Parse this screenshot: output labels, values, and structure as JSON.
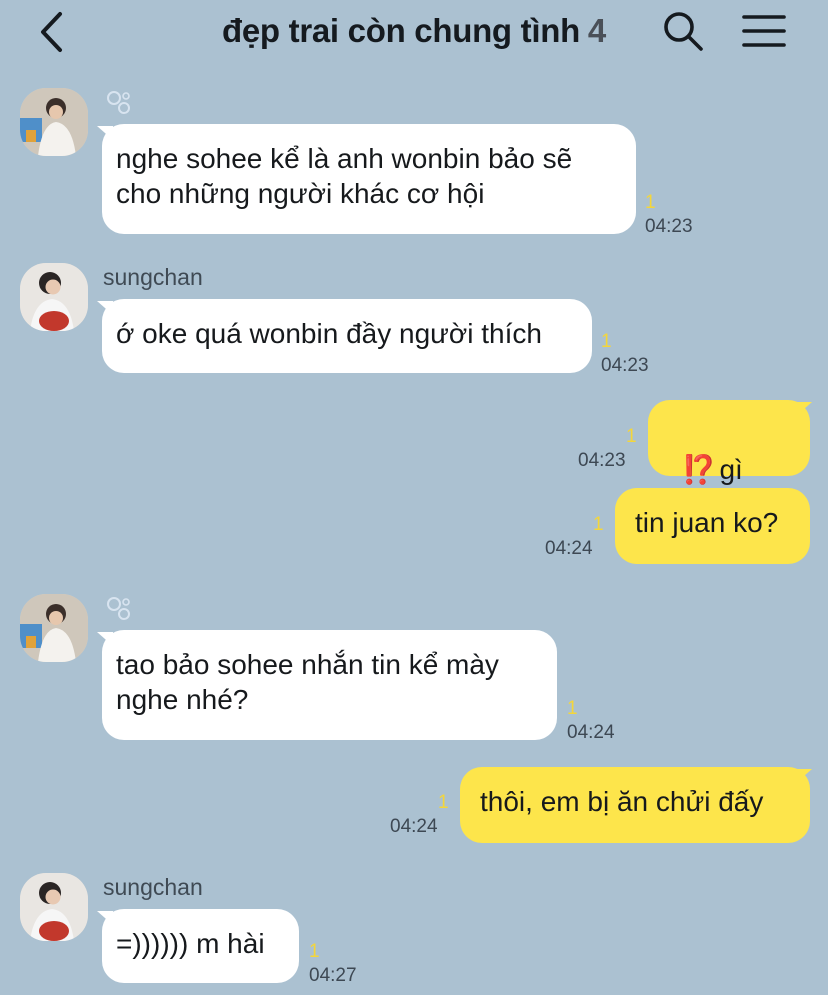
{
  "header": {
    "title": "đẹp trai còn chung tình",
    "member_count": "4"
  },
  "messages": [
    {
      "direction": "in",
      "sender": "",
      "text": "nghe sohee kể là anh wonbin bảo sẽ\ncho những người khác cơ hội",
      "unread": "1",
      "time": "04:23"
    },
    {
      "direction": "in",
      "sender": "sungchan",
      "text": "ớ oke quá wonbin đầy người thích",
      "unread": "1",
      "time": "04:23"
    },
    {
      "direction": "out",
      "emoji": "⁉️",
      "text": "gì vậy",
      "unread": "1",
      "time": "04:23"
    },
    {
      "direction": "out",
      "text": "tin juan ko?",
      "unread": "1",
      "time": "04:24"
    },
    {
      "direction": "in",
      "sender": "",
      "text": "tao bảo sohee nhắn tin kể mày\nnghe nhé?",
      "unread": "1",
      "time": "04:24"
    },
    {
      "direction": "out",
      "text": "thôi, em bị ăn chửi đấy",
      "unread": "1",
      "time": "04:24"
    },
    {
      "direction": "in",
      "sender": "sungchan",
      "text": "=)))))) m hài",
      "unread": "1",
      "time": "04:27"
    }
  ]
}
